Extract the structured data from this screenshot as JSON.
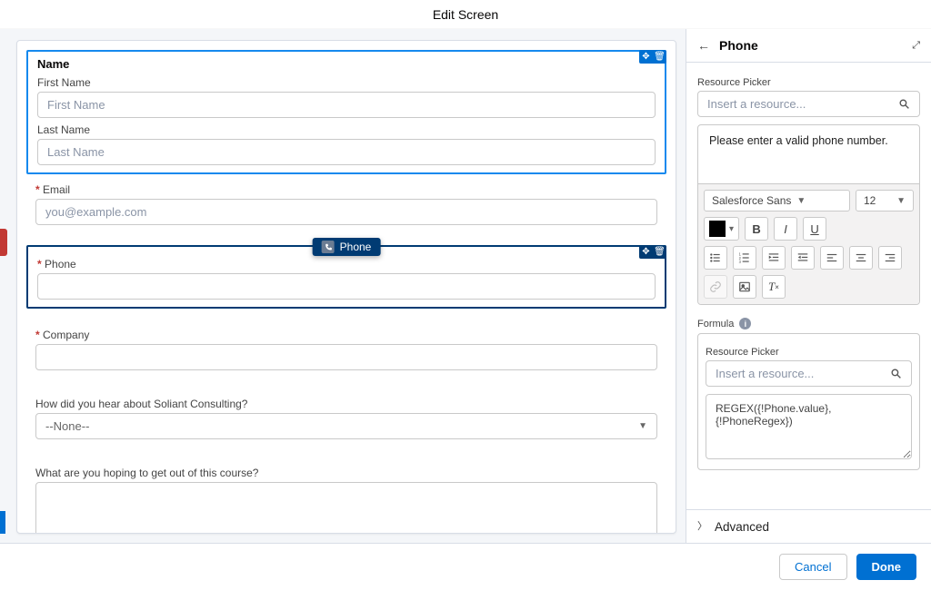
{
  "header": {
    "title": "Edit Screen"
  },
  "canvas": {
    "name_section": {
      "title": "Name",
      "first_label": "First Name",
      "first_placeholder": "First Name",
      "last_label": "Last Name",
      "last_placeholder": "Last Name"
    },
    "email": {
      "label": "Email",
      "placeholder": "you@example.com"
    },
    "phone": {
      "label": "Phone",
      "chip_label": "Phone"
    },
    "company": {
      "label": "Company"
    },
    "referral": {
      "label": "How did you hear about Soliant Consulting?",
      "selected": "--None--"
    },
    "goal": {
      "label": "What are you hoping to get out of this course?"
    }
  },
  "panel": {
    "title": "Phone",
    "resource_picker_label": "Resource Picker",
    "resource_picker_placeholder": "Insert a resource...",
    "error_text": "Please enter a valid phone number.",
    "font_family": "Salesforce Sans",
    "font_size": "12",
    "formula_label": "Formula",
    "formula_resource_placeholder": "Insert a resource...",
    "formula_expr": "REGEX({!Phone.value},{!PhoneRegex})",
    "advanced_label": "Advanced"
  },
  "footer": {
    "cancel": "Cancel",
    "done": "Done"
  }
}
